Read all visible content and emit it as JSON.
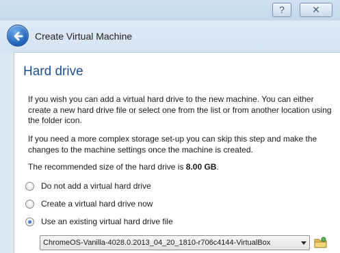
{
  "window": {
    "help_label": "?",
    "close_label": "✕"
  },
  "header": {
    "title": "Create Virtual Machine"
  },
  "page": {
    "title": "Hard drive",
    "paragraph1": "If you wish you can add a virtual hard drive to the new machine. You can either create a new hard drive file or select one from the list or from another location using the folder icon.",
    "paragraph2": "If you need a more complex storage set-up you can skip this step and make the changes to the machine settings once the machine is created.",
    "recommended_prefix": "The recommended size of the hard drive is ",
    "recommended_size": "8.00 GB",
    "recommended_suffix": "."
  },
  "options": [
    {
      "label": "Do not add a virtual hard drive",
      "checked": false
    },
    {
      "label": "Create a virtual hard drive now",
      "checked": false
    },
    {
      "label": "Use an existing virtual hard drive file",
      "checked": true
    }
  ],
  "disk_select": {
    "value": "ChromeOS-Vanilla-4028.0.2013_04_20_1810-r706c4144-VirtualBox"
  },
  "icons": {
    "back": "back-arrow-icon",
    "folder": "folder-icon",
    "dropdown": "chevron-down-icon"
  },
  "colors": {
    "title_blue": "#1f4f8f",
    "window_frame": "#dce8f3"
  }
}
